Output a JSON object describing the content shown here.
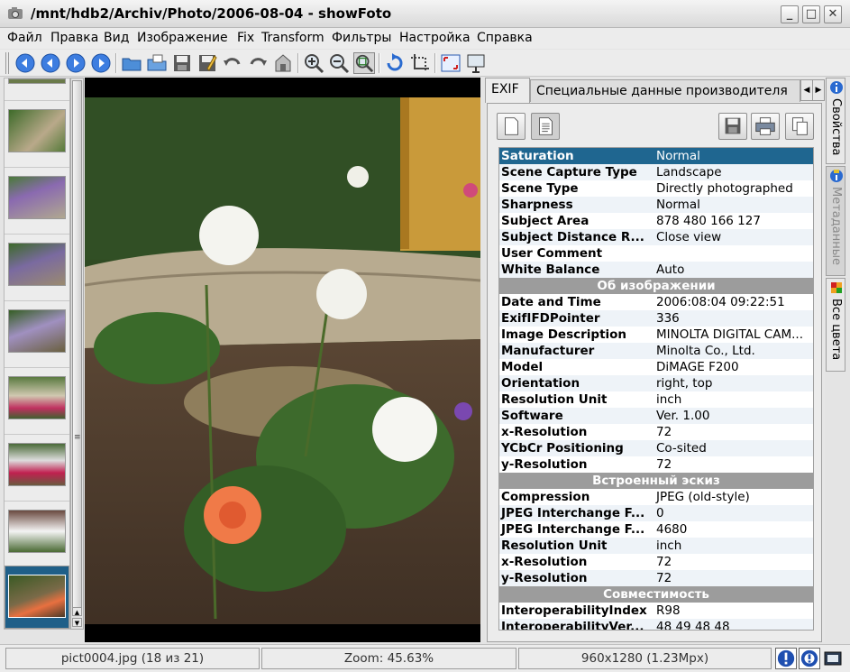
{
  "window": {
    "title": "/mnt/hdb2/Archiv/Photo/2006-08-04 - showFoto"
  },
  "menu": [
    "Файл",
    "Правка",
    "Вид",
    "Изображение",
    "Fix",
    "Transform",
    "Фильтры",
    "Настройка",
    "Справка"
  ],
  "toolbar": {
    "icons": [
      "back-icon",
      "forward-icon",
      "first-icon",
      "last-icon",
      "open-folder-icon",
      "open-file-icon",
      "save-icon",
      "save-as-icon",
      "undo-icon",
      "redo-icon",
      "revert-icon",
      "zoom-in-icon",
      "zoom-out-icon",
      "zoom-fit-icon",
      "rotate-icon",
      "crop-icon",
      "fullscreen-icon",
      "slideshow-icon"
    ]
  },
  "thumbnails": {
    "count_visible": 8,
    "selected_index": 7
  },
  "panel": {
    "tabs": [
      "EXIF",
      "Специальные данные производителя"
    ],
    "active_tab": "EXIF",
    "rows": [
      {
        "type": "row",
        "key": "Saturation",
        "value": "Normal",
        "selected": true
      },
      {
        "type": "row",
        "key": "Scene Capture Type",
        "value": "Landscape"
      },
      {
        "type": "row",
        "key": "Scene Type",
        "value": "Directly photographed"
      },
      {
        "type": "row",
        "key": "Sharpness",
        "value": "Normal"
      },
      {
        "type": "row",
        "key": "Subject Area",
        "value": "878 480 166 127"
      },
      {
        "type": "row",
        "key": "Subject Distance R...",
        "value": "Close view"
      },
      {
        "type": "row",
        "key": "User Comment",
        "value": ""
      },
      {
        "type": "row",
        "key": "White Balance",
        "value": "Auto"
      },
      {
        "type": "section",
        "key": "Об изображении"
      },
      {
        "type": "row",
        "key": "Date and Time",
        "value": "2006:08:04 09:22:51"
      },
      {
        "type": "row",
        "key": "ExifIFDPointer",
        "value": "336"
      },
      {
        "type": "row",
        "key": "Image Description",
        "value": "MINOLTA DIGITAL CAM..."
      },
      {
        "type": "row",
        "key": "Manufacturer",
        "value": "Minolta Co., Ltd."
      },
      {
        "type": "row",
        "key": "Model",
        "value": "DiMAGE F200"
      },
      {
        "type": "row",
        "key": "Orientation",
        "value": "right, top"
      },
      {
        "type": "row",
        "key": "Resolution Unit",
        "value": "inch"
      },
      {
        "type": "row",
        "key": "Software",
        "value": "Ver. 1.00"
      },
      {
        "type": "row",
        "key": "x-Resolution",
        "value": "72"
      },
      {
        "type": "row",
        "key": "YCbCr Positioning",
        "value": "Co-sited"
      },
      {
        "type": "row",
        "key": "y-Resolution",
        "value": "72"
      },
      {
        "type": "section",
        "key": "Встроенный эскиз"
      },
      {
        "type": "row",
        "key": "Compression",
        "value": "JPEG (old-style)"
      },
      {
        "type": "row",
        "key": "JPEG Interchange F...",
        "value": "0"
      },
      {
        "type": "row",
        "key": "JPEG Interchange F...",
        "value": "4680"
      },
      {
        "type": "row",
        "key": "Resolution Unit",
        "value": "inch"
      },
      {
        "type": "row",
        "key": "x-Resolution",
        "value": "72"
      },
      {
        "type": "row",
        "key": "y-Resolution",
        "value": "72"
      },
      {
        "type": "section",
        "key": "Совместимость"
      },
      {
        "type": "row",
        "key": "InteroperabilityIndex",
        "value": "R98"
      },
      {
        "type": "row",
        "key": "InteroperabilityVer...",
        "value": "48 49 48 48"
      }
    ]
  },
  "sidebar_tabs": [
    {
      "label": "Свойства",
      "icon": "info-icon",
      "enabled": true
    },
    {
      "label": "Метаданные",
      "icon": "metadata-icon",
      "enabled": false
    },
    {
      "label": "Все цвета",
      "icon": "colors-icon",
      "enabled": true
    }
  ],
  "status": {
    "file": "pict0004.jpg (18 из 21)",
    "zoom": "Zoom: 45.63%",
    "size": "960x1280 (1.23Mpx)"
  },
  "colors": {
    "selection": "#1f6690",
    "section_header": "#9c9c9c",
    "row_alt": "#eef3f8"
  }
}
